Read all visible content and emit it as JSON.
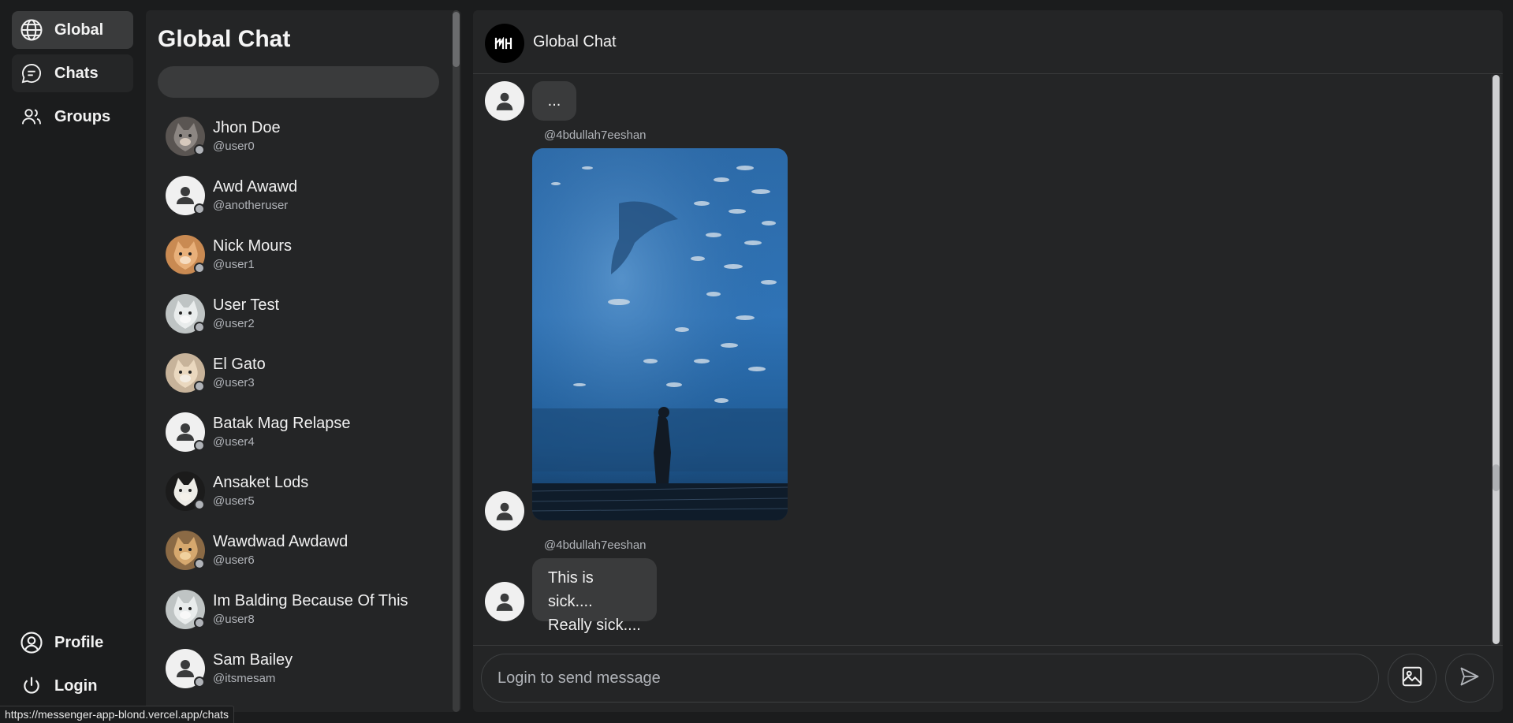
{
  "nav": {
    "items": [
      {
        "label": "Global",
        "icon": "globe-icon"
      },
      {
        "label": "Chats",
        "icon": "chat-bubble-icon"
      },
      {
        "label": "Groups",
        "icon": "users-icon"
      }
    ],
    "bottom": [
      {
        "label": "Profile",
        "icon": "user-circle-icon"
      },
      {
        "label": "Login",
        "icon": "power-icon"
      }
    ]
  },
  "sidebar": {
    "title": "Global Chat",
    "search_placeholder": "",
    "users": [
      {
        "name": "Jhon Doe",
        "handle": "@user0",
        "avatar": "cat-gray"
      },
      {
        "name": "Awd Awawd",
        "handle": "@anotheruser",
        "avatar": "default"
      },
      {
        "name": "Nick Mours",
        "handle": "@user1",
        "avatar": "cat-orange"
      },
      {
        "name": "User Test",
        "handle": "@user2",
        "avatar": "cat-white"
      },
      {
        "name": "El Gato",
        "handle": "@user3",
        "avatar": "cat-kitten"
      },
      {
        "name": "Batak Mag Relapse",
        "handle": "@user4",
        "avatar": "default"
      },
      {
        "name": "Ansaket Lods",
        "handle": "@user5",
        "avatar": "cat-meme"
      },
      {
        "name": "Wawdwad Awdawd",
        "handle": "@user6",
        "avatar": "cat-thumbs"
      },
      {
        "name": "Im Balding Because Of This",
        "handle": "@user8",
        "avatar": "cat-white"
      },
      {
        "name": "Sam Bailey",
        "handle": "@itsmesam",
        "avatar": "default"
      }
    ]
  },
  "chat": {
    "title": "Global Chat",
    "messages": [
      {
        "sender": "",
        "text": "..."
      },
      {
        "sender": "@4bdullah7eeshan",
        "type": "image",
        "image": "aquarium-photo"
      },
      {
        "sender": "@4bdullah7eeshan",
        "lines": [
          "This is sick....",
          "Really sick...."
        ]
      }
    ],
    "input_placeholder": "Login to send message",
    "attach_icon": "image-icon",
    "send_icon": "send-icon"
  },
  "status_url": "https://messenger-app-blond.vercel.app/chats",
  "colors": {
    "background": "#1b1c1d",
    "panel": "#242526",
    "bubble": "#3a3b3c",
    "active_nav": "#3a3b3c",
    "muted_text": "#b0b3b8"
  }
}
